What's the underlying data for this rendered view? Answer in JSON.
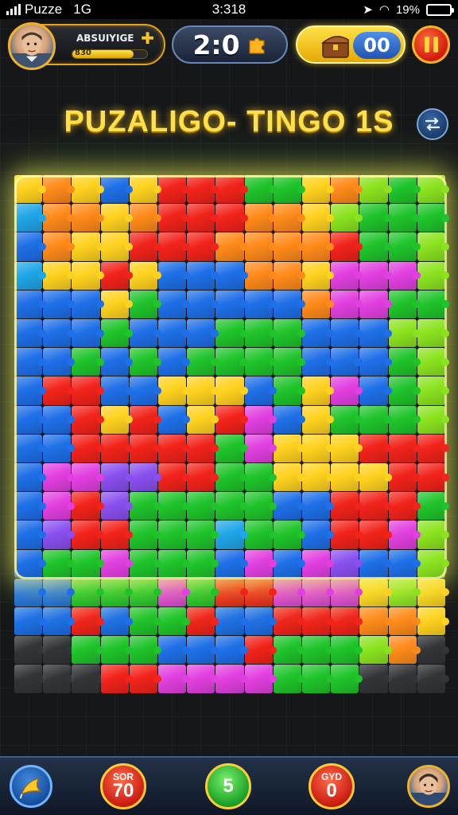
{
  "status_bar": {
    "carrier": "Puzze",
    "network": "1G",
    "time": "3:318",
    "battery": "19%",
    "battery_level": 0.19
  },
  "player": {
    "name": "ABSUIYIGE",
    "xp_text": "830",
    "xp_progress": 0.82,
    "avatar_icon": "player-avatar-icon",
    "add_icon": "plus-icon"
  },
  "score": {
    "value": "2:0",
    "icon": "puzzle-piece-icon"
  },
  "coins": {
    "value": "00",
    "icon": "treasure-chest-icon"
  },
  "pause": {
    "icon": "pause-icon"
  },
  "level": {
    "title": "PUZALIGO- TINGO 1S"
  },
  "settings": {
    "icon": "swap-arrows-icon"
  },
  "board": {
    "columns": 15,
    "rows": 16,
    "palette": {
      "R": "#f2231a",
      "O": "#ff8a1a",
      "Y": "#ffd21f",
      "G": "#1fc42b",
      "L": "#8be31f",
      "B": "#1e6fe8",
      "C": "#1fa6e8",
      "P": "#e23fe0",
      "V": "#8a4ff0",
      "K": "#3a3c40"
    },
    "layout": [
      "YOYBYRRRGGYOLGL",
      "COOYORRROOYLGGG",
      "BOYYRRROOOORGGL",
      "CYYRYBBBOOYPPPL",
      "BBBYGBBBBBOPPGG",
      "BBBGBBBGGGBBBLL",
      "BBGBGBGGGGBBBGL",
      "BRRBBYYYBGYPBGL",
      "BBRYRBYRPBYGGGL",
      "BBRRRRRGPYYYRRR",
      "BPPVVRRGGYYYYRR",
      "BPRVGGGGGBBRRRG",
      "BVRRGGGCGGBRRPL",
      "BGGPGGGBPBPVBBL",
      "BBGGGPGRRPPPYLY",
      "BBRBGGRBBRRROOY",
      "KKGGGBBBRGGGLOK",
      "KKKRRPPPPGGGKKK"
    ]
  },
  "bottom_bar": {
    "hint_icon": "hint-flag-icon",
    "counters": [
      {
        "label": "SOR",
        "value": "70",
        "color": "red"
      },
      {
        "label": "",
        "value": "5",
        "color": "green"
      },
      {
        "label": "GYD",
        "value": "0",
        "color": "red"
      }
    ],
    "profile_icon": "profile-avatar-icon"
  }
}
